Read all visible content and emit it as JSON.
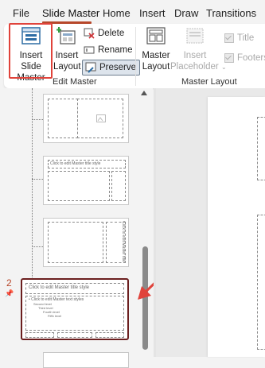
{
  "menu": {
    "file": "File",
    "slide_master": "Slide Master",
    "home": "Home",
    "insert": "Insert",
    "draw": "Draw",
    "transitions": "Transitions"
  },
  "ribbon": {
    "insert_slide_master_line1": "Insert Slide",
    "insert_slide_master_line2": "Master",
    "insert_layout_line1": "Insert",
    "insert_layout_line2": "Layout",
    "delete": "Delete",
    "rename": "Rename",
    "preserve": "Preserve",
    "edit_master_group": "Edit Master",
    "master_layout_line1": "Master",
    "master_layout_line2": "Layout",
    "insert_placeholder_line1": "Insert",
    "insert_placeholder_line2": "Placeholder",
    "title_checkbox": "Title",
    "footers_checkbox": "Footers",
    "master_layout_group": "Master Layout"
  },
  "thumbnails": {
    "slide_number": "2",
    "thumb_b_title": "Click to edit Master title style",
    "thumb_d_title": "Click to edit Master title style",
    "thumb_d_body": "• Click to edit Master text styles",
    "thumb_d_level2": "Second level",
    "thumb_d_level3": "Third level",
    "thumb_d_level4": "Fourth level",
    "thumb_d_level5": "Fifth level",
    "thumb_c_vertical": "Click to edit Master title"
  },
  "colors": {
    "accent": "#b7472a",
    "highlight_box": "#e0433b",
    "selected_border": "#6b1f1f",
    "annotation_arrow": "#e0433b"
  }
}
